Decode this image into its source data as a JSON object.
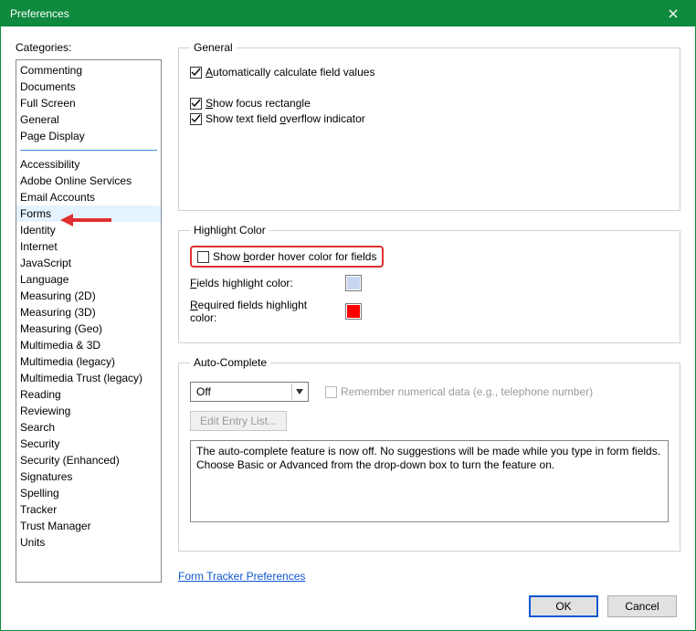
{
  "window": {
    "title": "Preferences"
  },
  "categories": {
    "label": "Categories:",
    "top_items": [
      "Commenting",
      "Documents",
      "Full Screen",
      "General",
      "Page Display"
    ],
    "bottom_items": [
      "Accessibility",
      "Adobe Online Services",
      "Email Accounts",
      "Forms",
      "Identity",
      "Internet",
      "JavaScript",
      "Language",
      "Measuring (2D)",
      "Measuring (3D)",
      "Measuring (Geo)",
      "Multimedia & 3D",
      "Multimedia (legacy)",
      "Multimedia Trust (legacy)",
      "Reading",
      "Reviewing",
      "Search",
      "Security",
      "Security (Enhanced)",
      "Signatures",
      "Spelling",
      "Tracker",
      "Trust Manager",
      "Units"
    ],
    "selected": "Forms"
  },
  "general": {
    "legend": "General",
    "auto_calc": "Automatically calculate field values",
    "focus_rect": "Show focus rectangle",
    "overflow": "Show text field overflow indicator"
  },
  "highlight": {
    "legend": "Highlight Color",
    "show_border_pre": "Show ",
    "show_border_u": "b",
    "show_border_post": "order hover color for fields",
    "fields_label_u": "F",
    "fields_label_post": "ields highlight color:",
    "required_label_u": "R",
    "required_label_post": "equired fields highlight color:",
    "fields_color": "#c9d6ef",
    "required_color": "#ff0000"
  },
  "auto_complete": {
    "legend": "Auto-Complete",
    "mode": "Off",
    "remember": "Remember numerical data (e.g., telephone number)",
    "edit_entry": "Edit Entry List...",
    "description": "The auto-complete feature is now off. No suggestions will be made while you type in form fields. Choose Basic or Advanced from the drop-down box to turn the feature on."
  },
  "link": {
    "label": "Form Tracker Preferences"
  },
  "buttons": {
    "ok": "OK",
    "cancel": "Cancel"
  }
}
